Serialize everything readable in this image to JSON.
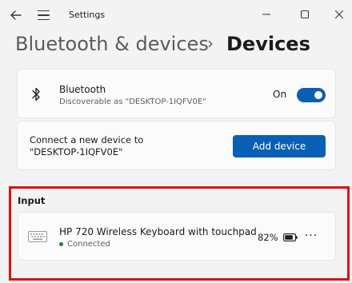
{
  "window": {
    "app_title": "Settings"
  },
  "header": {
    "breadcrumb_parent": "Bluetooth & devices",
    "breadcrumb_separator": "›",
    "breadcrumb_current": "Devices"
  },
  "bluetooth": {
    "title": "Bluetooth",
    "subtitle": "Discoverable as \"DESKTOP-1IQFV0E\"",
    "state_label": "On",
    "enabled": true
  },
  "add_device": {
    "text_line1": "Connect a new device to",
    "text_line2": "\"DESKTOP-1IQFV0E\"",
    "button_label": "Add device"
  },
  "input_section": {
    "label": "Input",
    "devices": [
      {
        "name": "HP 720 Wireless Keyboard with touchpad",
        "status": "Connected",
        "battery": "82%",
        "more": "···"
      }
    ]
  },
  "icons": {
    "back": "back-arrow-icon",
    "menu": "hamburger-menu-icon",
    "minimize": "minimize-icon",
    "maximize": "maximize-icon",
    "close": "close-icon",
    "bluetooth": "bluetooth-icon",
    "keyboard": "keyboard-icon",
    "battery": "battery-icon"
  },
  "colors": {
    "accent": "#0a5fb4",
    "highlight": "#e01010",
    "status_connected": "#10893e"
  }
}
